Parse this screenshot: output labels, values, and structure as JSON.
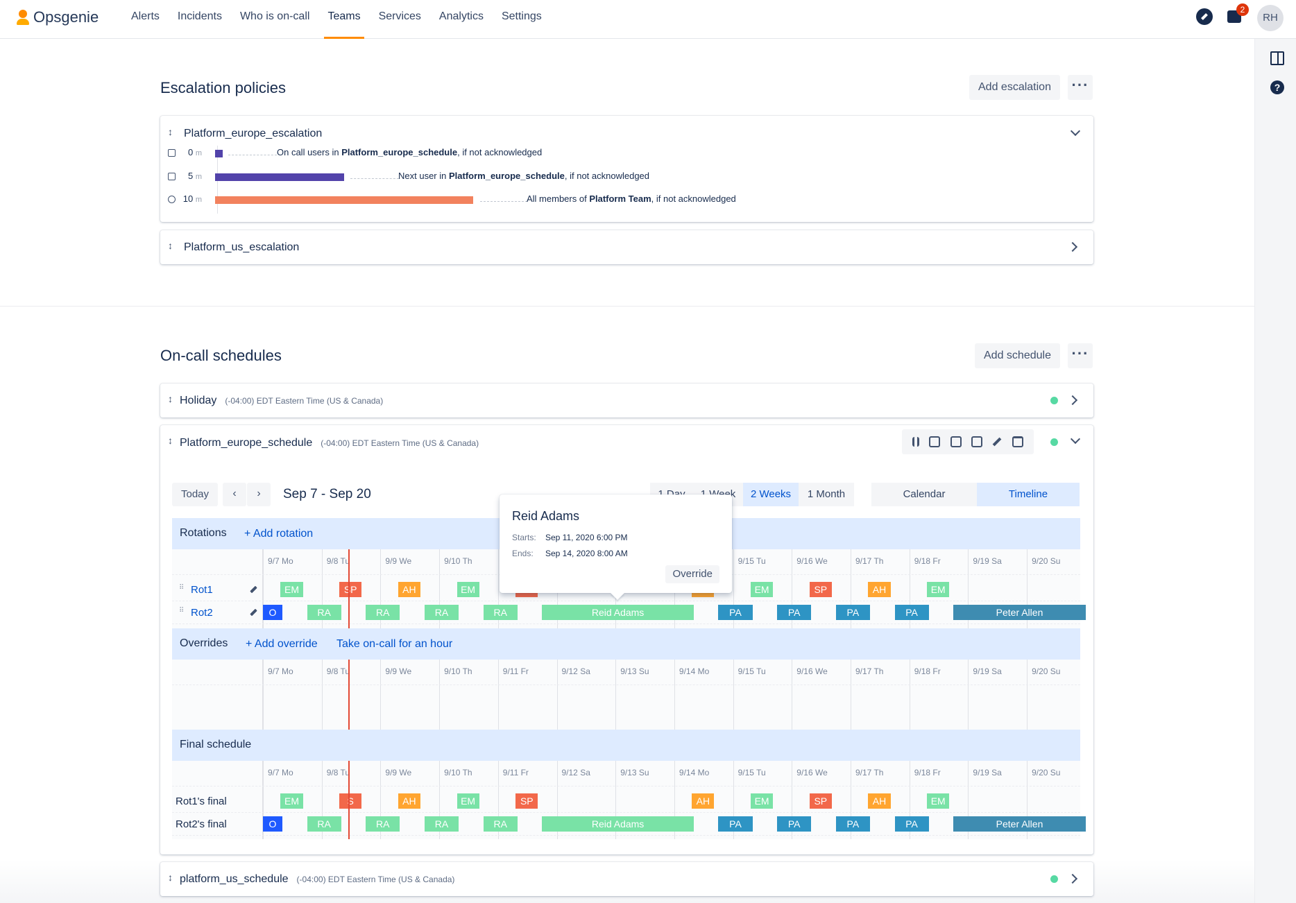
{
  "app": {
    "name": "Opsgenie",
    "user_initials": "RH",
    "notification_count": "2"
  },
  "nav": {
    "items": [
      {
        "label": "Alerts"
      },
      {
        "label": "Incidents"
      },
      {
        "label": "Who is on-call"
      },
      {
        "label": "Teams"
      },
      {
        "label": "Services"
      },
      {
        "label": "Analytics"
      },
      {
        "label": "Settings"
      }
    ],
    "active": "Teams"
  },
  "escalation": {
    "title": "Escalation policies",
    "add_label": "Add escalation",
    "policies": [
      {
        "name": "Platform_europe_escalation",
        "expanded": true,
        "rules": [
          {
            "time": "0",
            "unit": "m",
            "pre": "On call users in ",
            "target": "Platform_europe_schedule",
            "post": ", if not acknowledged"
          },
          {
            "time": "5",
            "unit": "m",
            "pre": "Next user in ",
            "target": "Platform_europe_schedule",
            "post": ", if not acknowledged"
          },
          {
            "time": "10",
            "unit": "m",
            "pre": "All members of ",
            "target": "Platform Team",
            "post": ", if not acknowledged"
          }
        ]
      },
      {
        "name": "Platform_us_escalation",
        "expanded": false
      }
    ]
  },
  "schedules": {
    "title": "On-call schedules",
    "add_label": "Add schedule",
    "items": [
      {
        "name": "Holiday",
        "tz": "(-04:00) EDT Eastern Time (US & Canada)"
      },
      {
        "name": "Platform_europe_schedule",
        "tz": "(-04:00) EDT Eastern Time (US & Canada)"
      },
      {
        "name": "platform_us_schedule",
        "tz": "(-04:00) EDT Eastern Time (US & Canada)"
      }
    ]
  },
  "timeline": {
    "today": "Today",
    "range": "Sep 7 - Sep 20",
    "zoom": [
      "1 Day",
      "1 Week",
      "2 Weeks",
      "1 Month"
    ],
    "active_zoom": "2 Weeks",
    "views": [
      "Calendar",
      "Timeline"
    ],
    "active_view": "Timeline",
    "days": [
      "9/7 Mo",
      "9/8 Tu",
      "9/9 We",
      "9/10 Th",
      "9/11 Fr",
      "9/12 Sa",
      "9/13 Su",
      "9/14 Mo",
      "9/15 Tu",
      "9/16 We",
      "9/17 Th",
      "9/18 Fr",
      "9/19 Sa",
      "9/20 Su"
    ],
    "rotations_label": "Rotations",
    "add_rotation": "+ Add rotation",
    "overrides_label": "Overrides",
    "add_override": "+ Add override",
    "take_oncall": "Take on-call for an hour",
    "final_label": "Final schedule",
    "rot_rows": [
      {
        "name": "Rot1",
        "blocks": [
          {
            "t": "EM",
            "c": "EM",
            "d": 0.3,
            "w": 0.38
          },
          {
            "t": "SP",
            "c": "SP",
            "d": 1.3,
            "w": 0.38
          },
          {
            "t": "AH",
            "c": "AH",
            "d": 2.3,
            "w": 0.38
          },
          {
            "t": "EM",
            "c": "EM",
            "d": 3.3,
            "w": 0.38
          },
          {
            "t": "",
            "c": "SP",
            "d": 4.3,
            "w": 0.38
          },
          {
            "t": "",
            "c": "AH",
            "d": 7.3,
            "w": 0.38
          },
          {
            "t": "EM",
            "c": "EM",
            "d": 8.3,
            "w": 0.38
          },
          {
            "t": "SP",
            "c": "SP",
            "d": 9.3,
            "w": 0.38
          },
          {
            "t": "AH",
            "c": "AH",
            "d": 10.3,
            "w": 0.38
          },
          {
            "t": "EM",
            "c": "EM",
            "d": 11.3,
            "w": 0.38
          }
        ]
      },
      {
        "name": "Rot2",
        "blocks": [
          {
            "t": "O",
            "c": "O",
            "d": 0.0,
            "w": 0.33
          },
          {
            "t": "RA",
            "c": "RA",
            "d": 0.75,
            "w": 0.58
          },
          {
            "t": "RA",
            "c": "RA",
            "d": 1.75,
            "w": 0.58
          },
          {
            "t": "RA",
            "c": "RA",
            "d": 2.75,
            "w": 0.58
          },
          {
            "t": "RA",
            "c": "RA",
            "d": 3.75,
            "w": 0.58
          },
          {
            "t": "Reid Adams",
            "c": "RA",
            "d": 4.75,
            "w": 2.58
          },
          {
            "t": "PA",
            "c": "PA",
            "d": 7.75,
            "w": 0.58
          },
          {
            "t": "PA",
            "c": "PA",
            "d": 8.75,
            "w": 0.58
          },
          {
            "t": "PA",
            "c": "PA",
            "d": 9.75,
            "w": 0.58
          },
          {
            "t": "PA",
            "c": "PA",
            "d": 10.75,
            "w": 0.58
          },
          {
            "t": "Peter Allen",
            "c": "PT",
            "d": 11.75,
            "w": 2.25
          }
        ]
      }
    ],
    "final_rows": [
      {
        "name": "Rot1's final",
        "blocks": [
          {
            "t": "EM",
            "c": "EM",
            "d": 0.3,
            "w": 0.38
          },
          {
            "t": "S",
            "c": "SP",
            "d": 1.3,
            "w": 0.38
          },
          {
            "t": "AH",
            "c": "AH",
            "d": 2.3,
            "w": 0.38
          },
          {
            "t": "EM",
            "c": "EM",
            "d": 3.3,
            "w": 0.38
          },
          {
            "t": "SP",
            "c": "SP",
            "d": 4.3,
            "w": 0.38
          },
          {
            "t": "AH",
            "c": "AH",
            "d": 7.3,
            "w": 0.38
          },
          {
            "t": "EM",
            "c": "EM",
            "d": 8.3,
            "w": 0.38
          },
          {
            "t": "SP",
            "c": "SP",
            "d": 9.3,
            "w": 0.38
          },
          {
            "t": "AH",
            "c": "AH",
            "d": 10.3,
            "w": 0.38
          },
          {
            "t": "EM",
            "c": "EM",
            "d": 11.3,
            "w": 0.38
          }
        ]
      },
      {
        "name": "Rot2's final",
        "blocks": [
          {
            "t": "O",
            "c": "O",
            "d": 0.0,
            "w": 0.33
          },
          {
            "t": "RA",
            "c": "RA",
            "d": 0.75,
            "w": 0.58
          },
          {
            "t": "RA",
            "c": "RA",
            "d": 1.75,
            "w": 0.58
          },
          {
            "t": "RA",
            "c": "RA",
            "d": 2.75,
            "w": 0.58
          },
          {
            "t": "RA",
            "c": "RA",
            "d": 3.75,
            "w": 0.58
          },
          {
            "t": "Reid Adams",
            "c": "RA",
            "d": 4.75,
            "w": 2.58
          },
          {
            "t": "PA",
            "c": "PA",
            "d": 7.75,
            "w": 0.58
          },
          {
            "t": "PA",
            "c": "PA",
            "d": 8.75,
            "w": 0.58
          },
          {
            "t": "PA",
            "c": "PA",
            "d": 9.75,
            "w": 0.58
          },
          {
            "t": "PA",
            "c": "PA",
            "d": 10.75,
            "w": 0.58
          },
          {
            "t": "Peter Allen",
            "c": "PT",
            "d": 11.75,
            "w": 2.25
          }
        ]
      }
    ]
  },
  "tooltip": {
    "name": "Reid Adams",
    "starts_label": "Starts:",
    "starts": "Sep 11, 2020 6:00 PM",
    "ends_label": "Ends:",
    "ends": "Sep 14, 2020 8:00 AM",
    "action": "Override"
  },
  "colors": {
    "EM": "#79e2a6",
    "SP": "#f2684a",
    "AH": "#ffa530",
    "RA": "#79e2a6",
    "O": "#1f5aff",
    "PA": "#2e94c4",
    "accent": "#0052cc",
    "nav_active": "#ff8b00"
  }
}
